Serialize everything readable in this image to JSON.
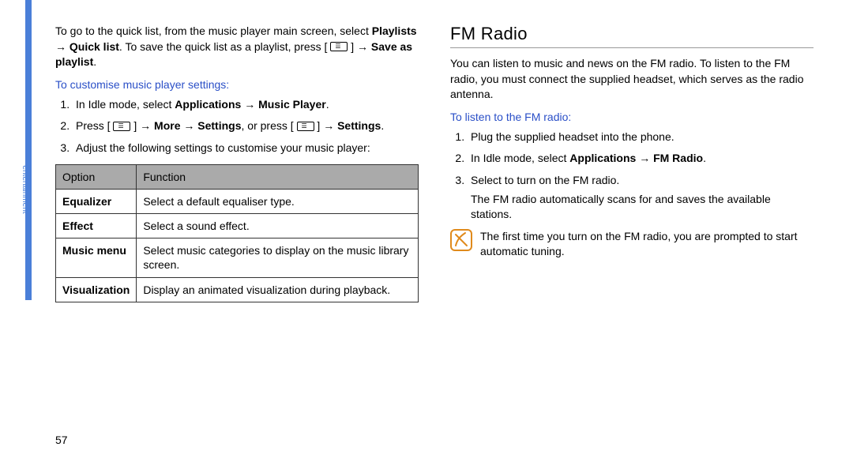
{
  "sidebar": {
    "label": "entertainment"
  },
  "page_number": "57",
  "left": {
    "intro": {
      "seg1": "To go to the quick list, from the music player main screen, select ",
      "bold1": "Playlists → Quick list",
      "seg2": ". To save the quick list as a playlist, press [ ",
      "seg3": " ] → ",
      "bold2": "Save as playlist",
      "seg4": "."
    },
    "subhead": "To customise music player settings:",
    "steps": {
      "s1": {
        "pre": "In Idle mode, select ",
        "bold": "Applications → Music Player",
        "post": "."
      },
      "s2": {
        "pre": "Press [ ",
        "mid1": " ] → ",
        "bold1": "More → Settings",
        "mid2": ", or press [ ",
        "mid3": " ] → ",
        "bold2": "Settings",
        "post": "."
      },
      "s3": "Adjust the following settings to customise your music player:"
    },
    "table": {
      "headers": {
        "col1": "Option",
        "col2": "Function"
      },
      "rows": [
        {
          "opt": "Equalizer",
          "func": "Select a default equaliser type."
        },
        {
          "opt": "Effect",
          "func": "Select a sound effect."
        },
        {
          "opt": "Music menu",
          "func": "Select music categories to display on the music library screen."
        },
        {
          "opt": "Visualization",
          "func": "Display an animated visualization during playback."
        }
      ]
    }
  },
  "right": {
    "heading": "FM Radio",
    "intro": "You can listen to music and news on the FM radio. To listen to the FM radio, you must connect the supplied headset, which serves as the radio antenna.",
    "subhead": "To listen to the FM radio:",
    "steps": {
      "s1": "Plug the supplied headset into the phone.",
      "s2": {
        "pre": "In Idle mode, select ",
        "bold": "Applications → FM Radio",
        "post": "."
      },
      "s3": {
        "line1": "Select      to turn on the FM radio.",
        "line2": "The FM radio automatically scans for and saves the available stations."
      }
    },
    "note": "The first time you turn on the FM radio, you are prompted to start automatic tuning."
  }
}
